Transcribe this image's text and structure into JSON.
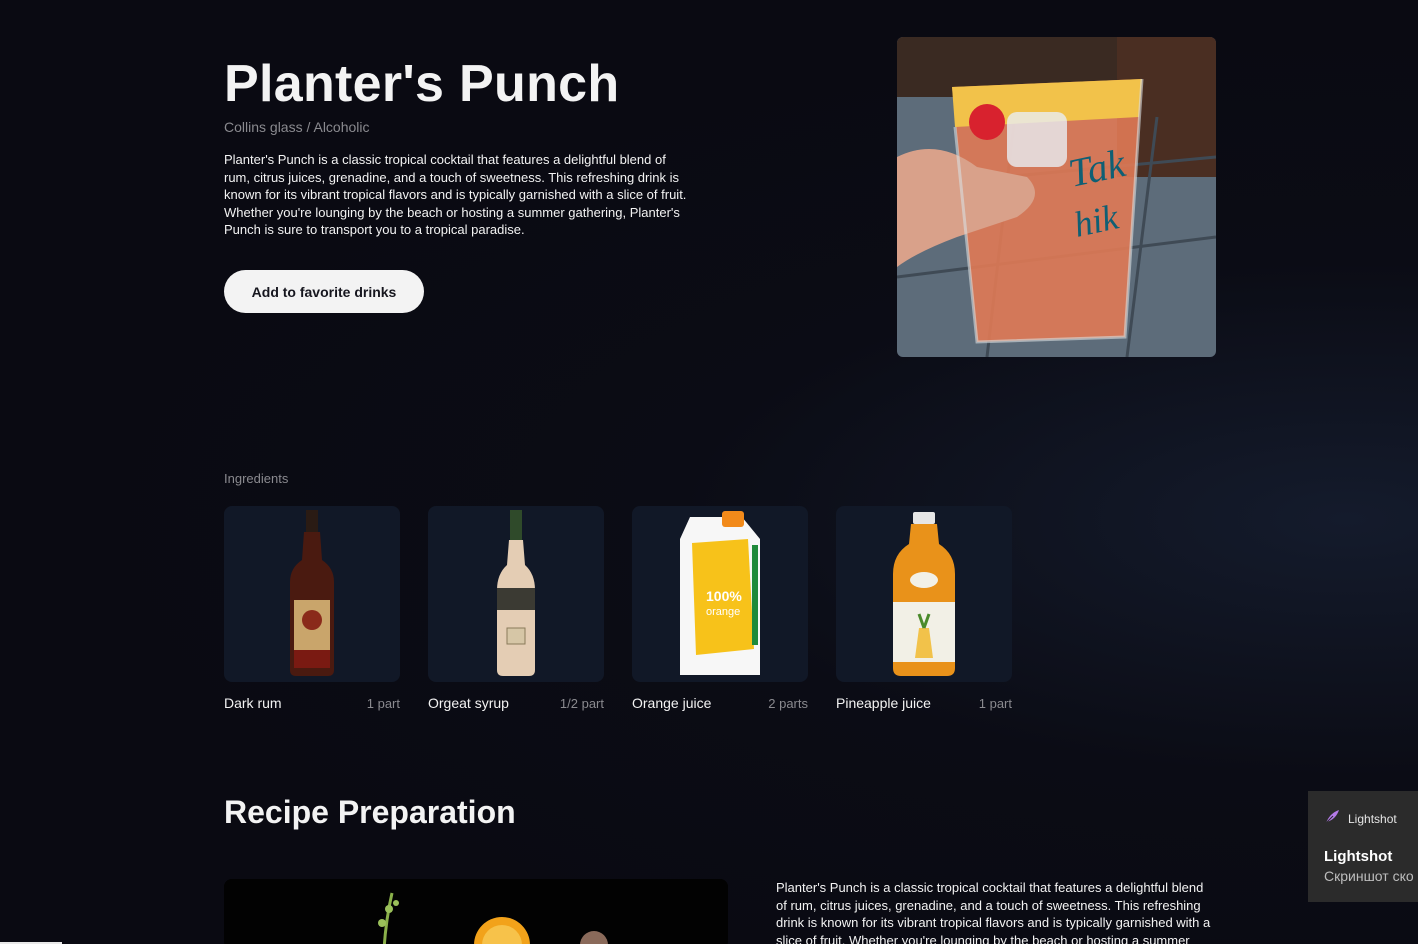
{
  "drink": {
    "title": "Planter's Punch",
    "subtitle": "Collins glass / Alcoholic",
    "description": "Planter's Punch is a classic tropical cocktail that features a delightful blend of rum, citrus juices, grenadine, and a touch of sweetness. This refreshing drink is known for its vibrant tropical flavors and is typically garnished with a slice of fruit. Whether you're lounging by the beach or hosting a summer gathering, Planter's Punch is sure to transport you to a tropical paradise.",
    "favorite_button": "Add to favorite drinks"
  },
  "ingredients": {
    "label": "Ingredients",
    "items": [
      {
        "name": "Dark rum",
        "qty": "1 part"
      },
      {
        "name": "Orgeat syrup",
        "qty": "1/2 part"
      },
      {
        "name": "Orange juice",
        "qty": "2 parts"
      },
      {
        "name": "Pineapple juice",
        "qty": "1 part"
      }
    ]
  },
  "recipe": {
    "title": "Recipe Preparation",
    "text": "Planter's Punch is a classic tropical cocktail that features a delightful blend of rum, citrus juices, grenadine, and a touch of sweetness. This refreshing drink is known for its vibrant tropical flavors and is typically garnished with a slice of fruit. Whether you're lounging by the beach or hosting a summer gathering"
  },
  "toast": {
    "app": "Lightshot",
    "title": "Lightshot",
    "body": "Скриншот ско"
  },
  "colors": {
    "background": "#0a0a12",
    "card": "#111827",
    "text": "#f3f3f3",
    "muted": "#8a8a8f",
    "button_bg": "#f3f3f3",
    "button_text": "#16161e"
  }
}
